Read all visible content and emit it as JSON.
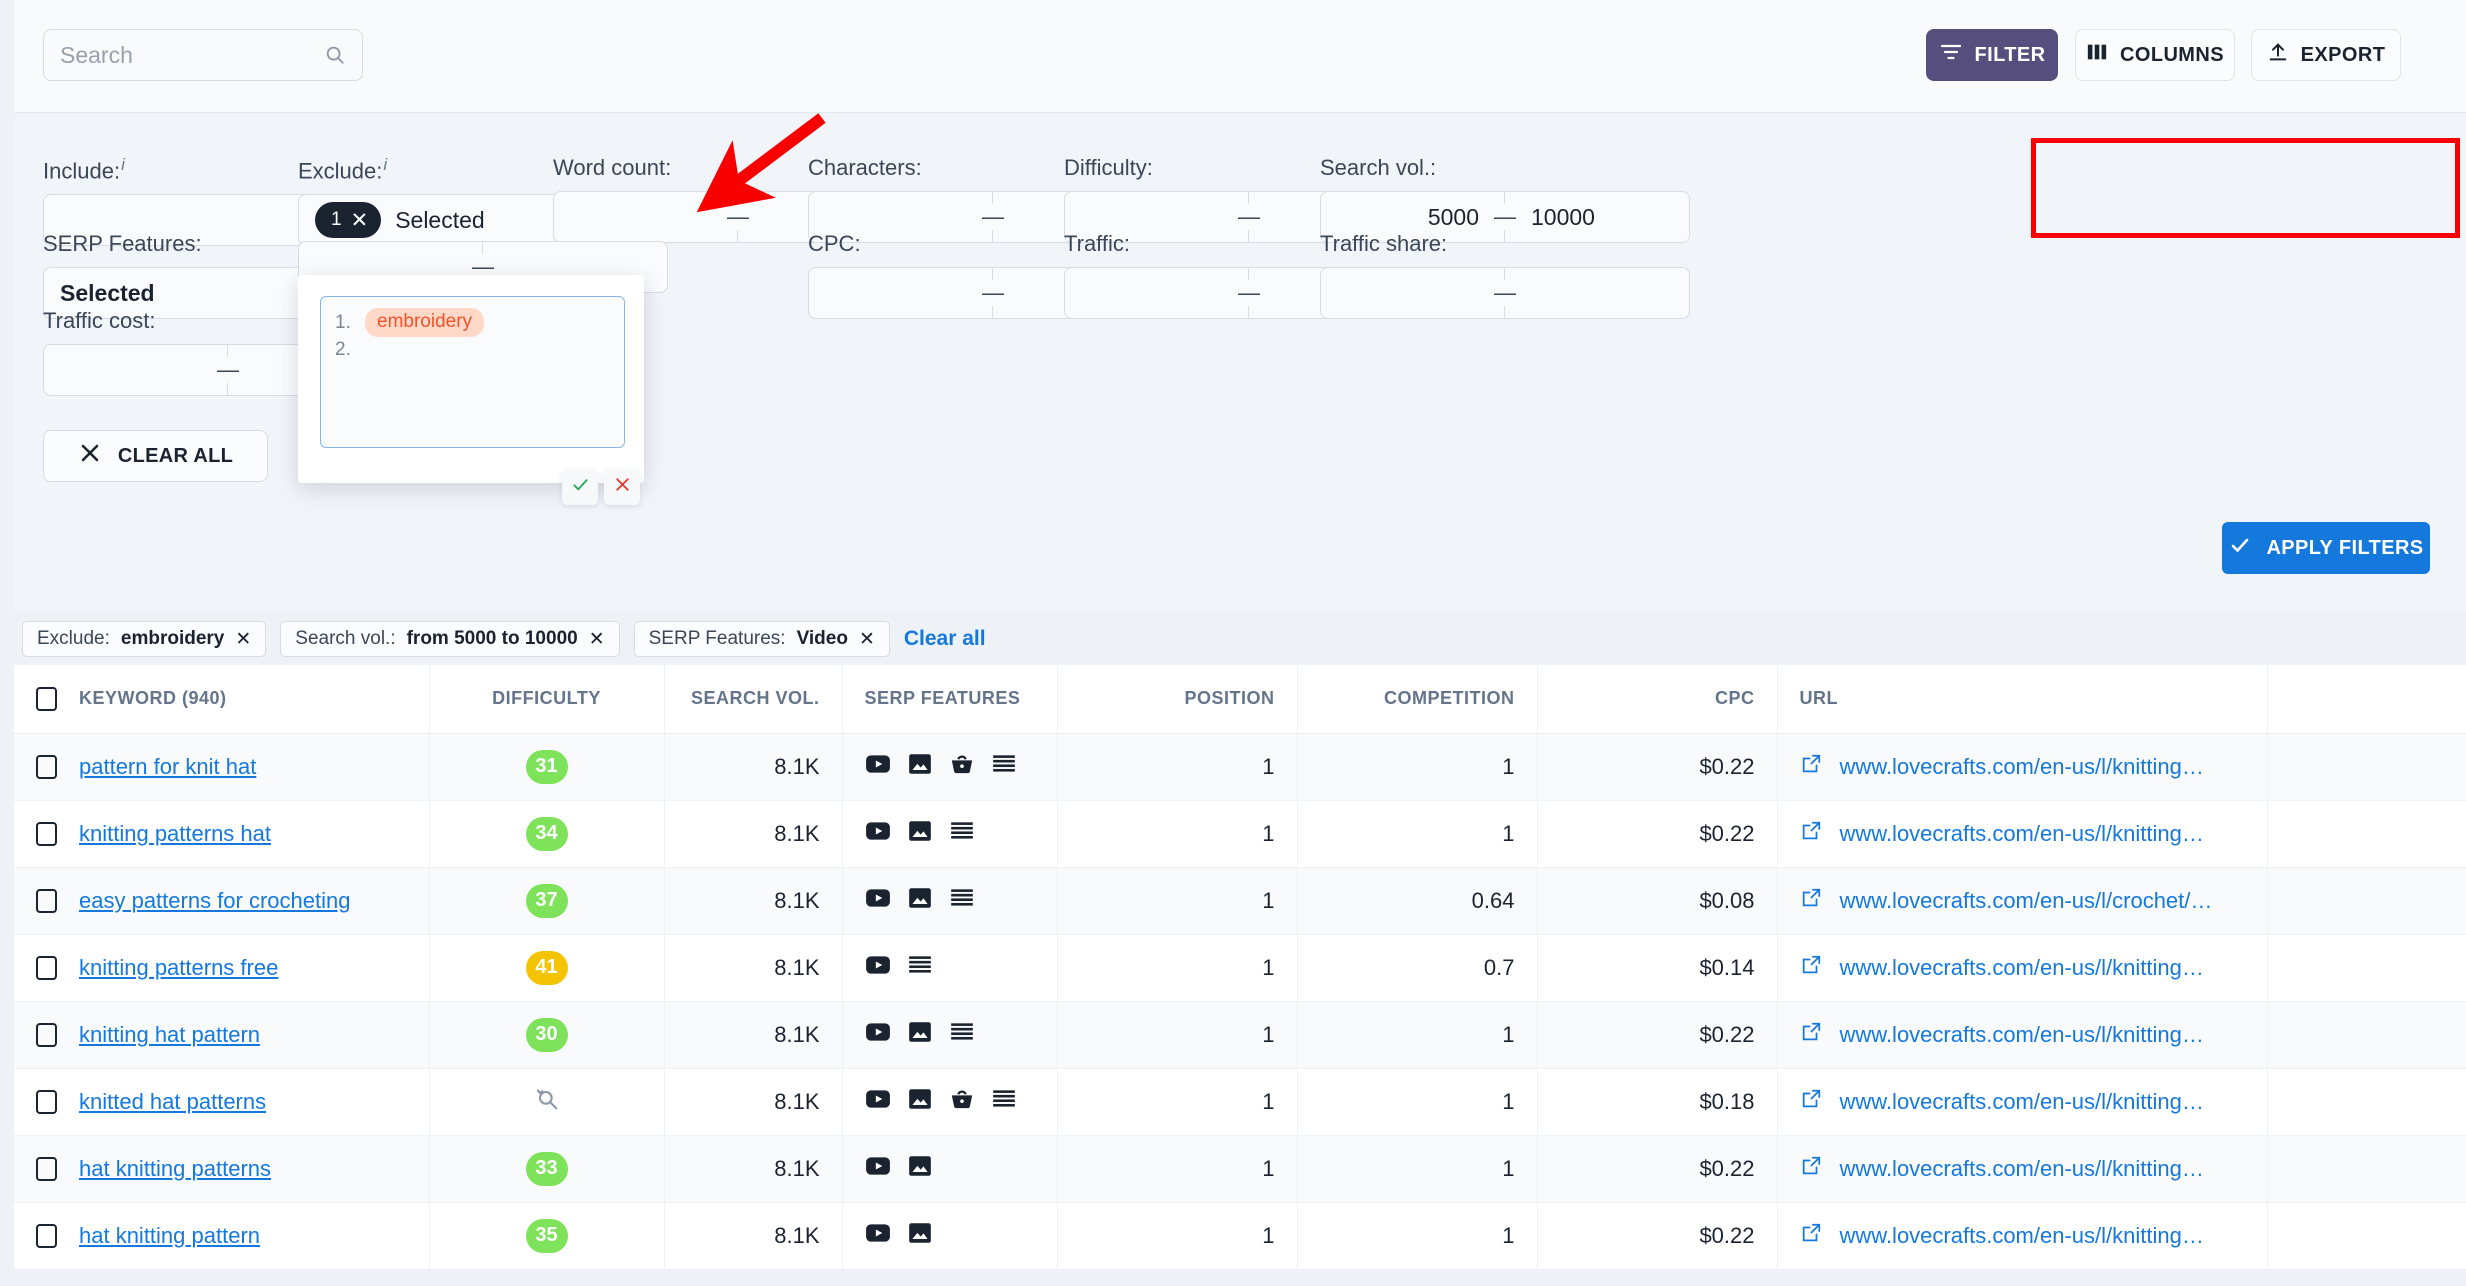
{
  "topbar": {
    "search": {
      "placeholder": "Search",
      "icon": "search-icon"
    },
    "filter_label": "FILTER",
    "columns_label": "COLUMNS",
    "export_label": "EXPORT"
  },
  "filters": {
    "include": {
      "label": "Include:",
      "info": "i",
      "value": ""
    },
    "exclude": {
      "label": "Exclude:",
      "info": "i",
      "count": "1",
      "value": "Selected"
    },
    "word_count": {
      "label": "Word count:",
      "min": "",
      "max": "",
      "dash": "—"
    },
    "characters": {
      "label": "Characters:",
      "min": "",
      "max": "",
      "dash": "—"
    },
    "difficulty": {
      "label": "Difficulty:",
      "min": "",
      "max": "",
      "dash": "—"
    },
    "search_vol": {
      "label": "Search vol.:",
      "min": "5000",
      "max": "10000",
      "dash": "—"
    },
    "serp_features": {
      "label": "SERP Features:",
      "value": "Selected"
    },
    "position": {
      "label": "",
      "min": "",
      "max": "",
      "dash": "—"
    },
    "cpc": {
      "label": "CPC:",
      "min": "",
      "max": "",
      "dash": "—"
    },
    "traffic": {
      "label": "Traffic:",
      "min": "",
      "max": "",
      "dash": "—"
    },
    "traffic_share": {
      "label": "Traffic share:",
      "min": "",
      "max": "",
      "dash": "—"
    },
    "traffic_cost": {
      "label": "Traffic cost:",
      "min": "",
      "max": "",
      "dash": "—"
    },
    "clear_all_label": "CLEAR ALL",
    "apply_label": "APPLY FILTERS",
    "highlight_color": "#f90000",
    "accent_color": "#1478dc"
  },
  "exclude_dropdown": {
    "rows": [
      {
        "num": "1.",
        "tag": "embroidery"
      },
      {
        "num": "2.",
        "tag": ""
      }
    ],
    "confirm_icon": "check-icon",
    "cancel_icon": "close-icon"
  },
  "active_filters": {
    "chips": [
      {
        "key": "Exclude:",
        "value": "embroidery"
      },
      {
        "key": "Search vol.:",
        "value": "from 5000 to 10000"
      },
      {
        "key": "SERP Features:",
        "value": "Video"
      }
    ],
    "clear_label": "Clear all"
  },
  "table": {
    "columns": [
      "KEYWORD  (940)",
      "DIFFICULTY",
      "SEARCH VOL.",
      "SERP FEATURES",
      "POSITION",
      "COMPETITION",
      "CPC",
      "URL",
      ""
    ],
    "rows": [
      {
        "keyword": "pattern for knit hat",
        "difficulty": "31",
        "difficulty_color": "#7ee25a",
        "volume": "8.1K",
        "serp": [
          "video-icon",
          "image-icon",
          "shopping-icon",
          "snippet-icon"
        ],
        "position": "1",
        "competition": "1",
        "cpc": "$0.22",
        "url": "www.lovecrafts.com/en-us/l/knitting…"
      },
      {
        "keyword": "knitting patterns hat",
        "difficulty": "34",
        "difficulty_color": "#7ee25a",
        "volume": "8.1K",
        "serp": [
          "video-icon",
          "image-icon",
          "snippet-icon"
        ],
        "position": "1",
        "competition": "1",
        "cpc": "$0.22",
        "url": "www.lovecrafts.com/en-us/l/knitting…"
      },
      {
        "keyword": "easy patterns for crocheting",
        "difficulty": "37",
        "difficulty_color": "#7ee25a",
        "volume": "8.1K",
        "serp": [
          "video-icon",
          "image-icon",
          "snippet-icon"
        ],
        "position": "1",
        "competition": "0.64",
        "cpc": "$0.08",
        "url": "www.lovecrafts.com/en-us/l/crochet/…"
      },
      {
        "keyword": "knitting patterns free",
        "difficulty": "41",
        "difficulty_color": "#f5c400",
        "volume": "8.1K",
        "serp": [
          "video-icon",
          "snippet-icon"
        ],
        "position": "1",
        "competition": "0.7",
        "cpc": "$0.14",
        "url": "www.lovecrafts.com/en-us/l/knitting…"
      },
      {
        "keyword": "knitting hat pattern",
        "difficulty": "30",
        "difficulty_color": "#7ee25a",
        "volume": "8.1K",
        "serp": [
          "video-icon",
          "image-icon",
          "snippet-icon"
        ],
        "position": "1",
        "competition": "1",
        "cpc": "$0.22",
        "url": "www.lovecrafts.com/en-us/l/knitting…"
      },
      {
        "keyword": "knitted hat patterns",
        "difficulty": "",
        "difficulty_color": "",
        "volume": "8.1K",
        "serp": [
          "video-icon",
          "image-icon",
          "shopping-icon",
          "snippet-icon"
        ],
        "position": "1",
        "competition": "1",
        "cpc": "$0.18",
        "url": "www.lovecrafts.com/en-us/l/knitting…"
      },
      {
        "keyword": "hat knitting patterns",
        "difficulty": "33",
        "difficulty_color": "#7ee25a",
        "volume": "8.1K",
        "serp": [
          "video-icon",
          "image-icon"
        ],
        "position": "1",
        "competition": "1",
        "cpc": "$0.22",
        "url": "www.lovecrafts.com/en-us/l/knitting…"
      },
      {
        "keyword": "hat knitting pattern",
        "difficulty": "35",
        "difficulty_color": "#7ee25a",
        "volume": "8.1K",
        "serp": [
          "video-icon",
          "image-icon"
        ],
        "position": "1",
        "competition": "1",
        "cpc": "$0.22",
        "url": "www.lovecrafts.com/en-us/l/knitting…"
      }
    ]
  }
}
